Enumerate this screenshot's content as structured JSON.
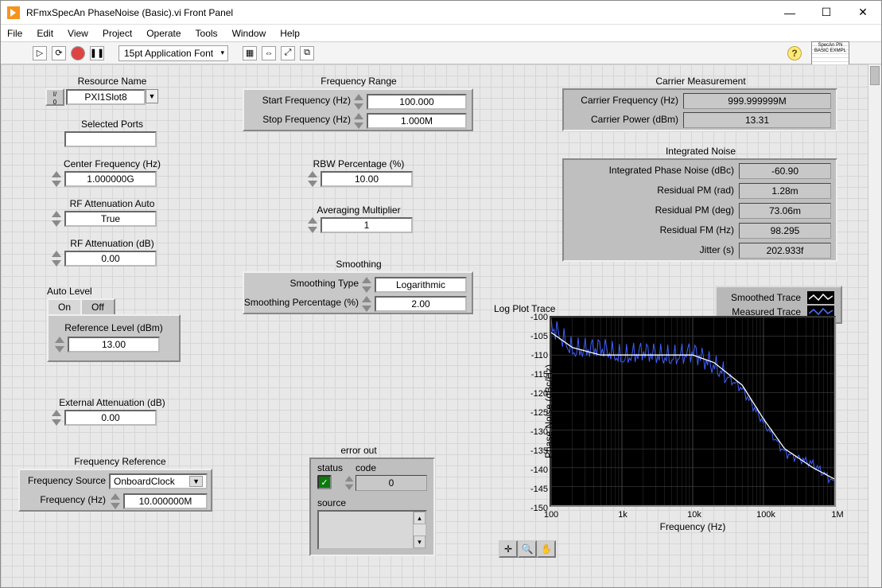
{
  "window": {
    "title": "RFmxSpecAn PhaseNoise (Basic).vi Front Panel"
  },
  "menu": {
    "file": "File",
    "edit": "Edit",
    "view": "View",
    "project": "Project",
    "operate": "Operate",
    "tools": "Tools",
    "window": "Window",
    "help": "Help"
  },
  "toolbar": {
    "font": "15pt Application Font",
    "example_badge": "SpecAn PN BASIC EXMPL"
  },
  "left": {
    "resource_name_label": "Resource Name",
    "resource_name_value": "PXI1Slot8",
    "selected_ports_label": "Selected Ports",
    "selected_ports_value": "",
    "center_freq_label": "Center Frequency (Hz)",
    "center_freq_value": "1.000000G",
    "rf_att_auto_label": "RF Attenuation Auto",
    "rf_att_auto_value": "True",
    "rf_att_label": "RF Attenuation (dB)",
    "rf_att_value": "0.00",
    "auto_level_label": "Auto Level",
    "tab_on": "On",
    "tab_off": "Off",
    "ref_level_label": "Reference Level (dBm)",
    "ref_level_value": "13.00",
    "ext_att_label": "External Attenuation (dB)",
    "ext_att_value": "0.00",
    "freq_ref_label": "Frequency Reference",
    "freq_source_label": "Frequency Source",
    "freq_source_value": "OnboardClock",
    "freq_hz_label": "Frequency (Hz)",
    "freq_hz_value": "10.000000M"
  },
  "mid": {
    "freq_range_label": "Frequency Range",
    "start_freq_label": "Start Frequency (Hz)",
    "start_freq_value": "100.000",
    "stop_freq_label": "Stop Frequency (Hz)",
    "stop_freq_value": "1.000M",
    "rbw_label": "RBW Percentage (%)",
    "rbw_value": "10.00",
    "avg_label": "Averaging Multiplier",
    "avg_value": "1",
    "smoothing_label": "Smoothing",
    "smoothing_type_label": "Smoothing Type",
    "smoothing_type_value": "Logarithmic",
    "smoothing_pct_label": "Smoothing Percentage (%)",
    "smoothing_pct_value": "2.00",
    "error_out_label": "error out",
    "status_label": "status",
    "code_label": "code",
    "code_value": "0",
    "source_label": "source",
    "source_value": ""
  },
  "right": {
    "carrier_meas_label": "Carrier Measurement",
    "carrier_freq_label": "Carrier Frequency (Hz)",
    "carrier_freq_value": "999.999999M",
    "carrier_power_label": "Carrier Power (dBm)",
    "carrier_power_value": "13.31",
    "int_noise_label": "Integrated Noise",
    "int_pn_label": "Integrated Phase Noise (dBc)",
    "int_pn_value": "-60.90",
    "res_pm_rad_label": "Residual PM (rad)",
    "res_pm_rad_value": "1.28m",
    "res_pm_deg_label": "Residual PM (deg)",
    "res_pm_deg_value": "73.06m",
    "res_fm_label": "Residual FM (Hz)",
    "res_fm_value": "98.295",
    "jitter_label": "Jitter (s)",
    "jitter_value": "202.933f",
    "legend_smoothed": "Smoothed Trace",
    "legend_measured": "Measured Trace",
    "plot_title": "Log Plot Trace",
    "ylabel": "Phase Noise (dBc/Hz)",
    "xlabel": "Frequency (Hz)",
    "yticks": [
      "-100",
      "-105",
      "-110",
      "-115",
      "-120",
      "-125",
      "-130",
      "-135",
      "-140",
      "-145",
      "-150"
    ],
    "xticks": [
      "100",
      "1k",
      "10k",
      "100k",
      "1M"
    ]
  },
  "chart_data": {
    "type": "line",
    "title": "Log Plot Trace",
    "xlabel": "Frequency (Hz)",
    "ylabel": "Phase Noise (dBc/Hz)",
    "xscale": "log",
    "ylim": [
      -150,
      -100
    ],
    "xlim": [
      100,
      1000000
    ],
    "series": [
      {
        "name": "Smoothed Trace",
        "color": "#ffffff",
        "x": [
          100,
          200,
          500,
          1000,
          2000,
          5000,
          10000,
          20000,
          50000,
          100000,
          200000,
          500000,
          1000000
        ],
        "y": [
          -104,
          -108,
          -110,
          -110,
          -110,
          -110,
          -110,
          -112,
          -118,
          -127,
          -135,
          -140,
          -143
        ]
      },
      {
        "name": "Measured Trace",
        "color": "#4060ff",
        "x": [
          100,
          200,
          500,
          1000,
          2000,
          5000,
          10000,
          20000,
          50000,
          100000,
          200000,
          500000,
          1000000
        ],
        "y": [
          -102,
          -109,
          -108,
          -111,
          -109,
          -111,
          -109,
          -113,
          -119,
          -128,
          -136,
          -139,
          -144
        ]
      }
    ]
  }
}
